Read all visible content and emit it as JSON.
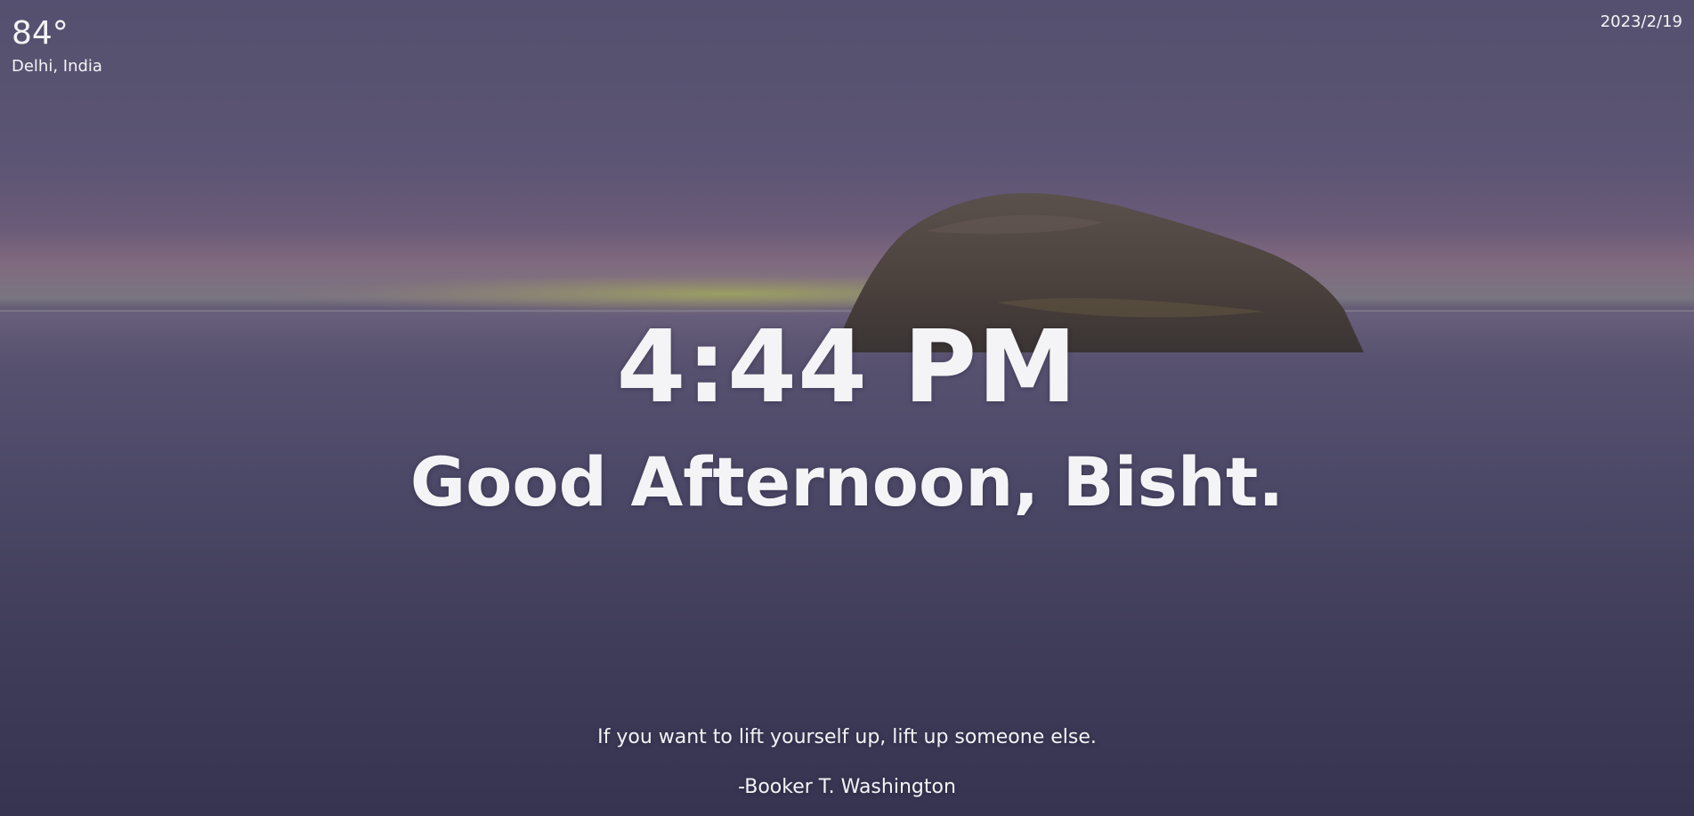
{
  "weather": {
    "temperature": "84°",
    "location": "Delhi, India"
  },
  "date": "2023/2/19",
  "clock": {
    "time": "4:44 PM"
  },
  "greeting": "Good Afternoon, Bisht.",
  "quote": {
    "text": "If you want to lift yourself up, lift up someone else.",
    "author": "-Booker T. Washington"
  },
  "background": {
    "sky_color": "#5a5475",
    "horizon_glow": "#9aa35a",
    "water_color": "#4a4664",
    "rock_color": "#4a4240"
  }
}
